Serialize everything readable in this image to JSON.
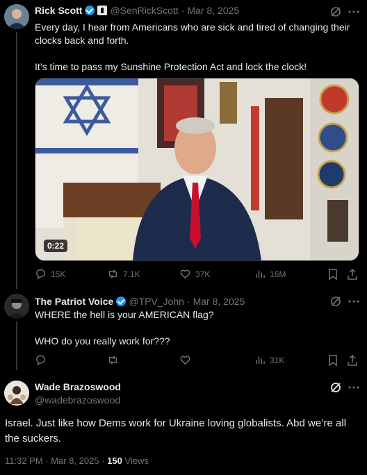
{
  "tweet1": {
    "author_name": "Rick Scott",
    "handle": "@SenRickScott",
    "date": "Mar 8, 2025",
    "text": "Every day, I hear from Americans who are sick and tired of changing their clocks back and forth.\n\nIt’s time to pass my Sunshine Protection Act and lock the clock!",
    "video_duration": "0:22",
    "stats": {
      "replies": "15K",
      "reposts": "7.1K",
      "likes": "37K",
      "views": "16M"
    }
  },
  "tweet2": {
    "author_name": "The Patriot Voice",
    "handle": "@TPV_John",
    "date": "Mar 8, 2025",
    "text": "WHERE the hell is your AMERICAN flag?\n\nWHO do you really work for???",
    "stats": {
      "views": "31K"
    }
  },
  "tweet3": {
    "author_name": "Wade Brazoswood",
    "handle": "@wadebrazoswood",
    "text": "Israel. Just like how Dems work for Ukraine loving globalists.  Abd we’re all the suckers.",
    "timestamp": "11:32 PM · Mar 8, 2025 ·",
    "views_count": "150",
    "views_label": "Views"
  },
  "separator": "·",
  "colors": {
    "accent": "#1d9bf0",
    "muted": "#71767b",
    "text": "#e7e9ea",
    "border": "#2f3336",
    "background": "#000000"
  }
}
